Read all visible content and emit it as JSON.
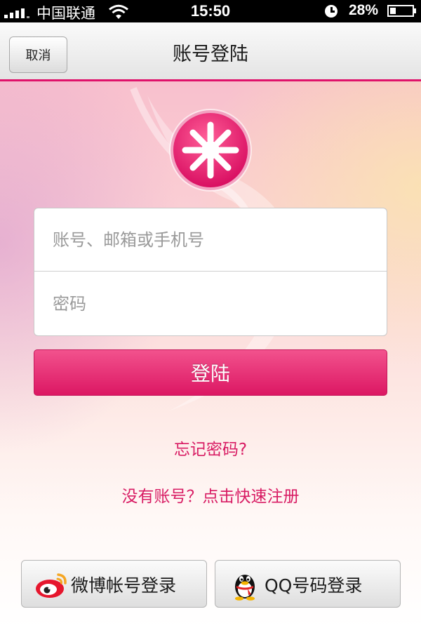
{
  "status_bar": {
    "carrier": "中国联通",
    "time": "15:50",
    "battery_percent": "28%",
    "battery_level": 0.28
  },
  "nav": {
    "cancel_label": "取消",
    "title": "账号登陆"
  },
  "form": {
    "account_placeholder": "账号、邮箱或手机号",
    "password_placeholder": "密码"
  },
  "login_button": "登陆",
  "links": {
    "forgot_password": "忘记密码?",
    "register": "没有账号？点击快速注册"
  },
  "social": {
    "weibo_label": "微博帐号登录",
    "qq_label": "QQ号码登录",
    "weibo_icon": "weibo-icon",
    "qq_icon": "qq-penguin-icon"
  },
  "colors": {
    "accent": "#e0126a",
    "link": "#d81b63"
  }
}
